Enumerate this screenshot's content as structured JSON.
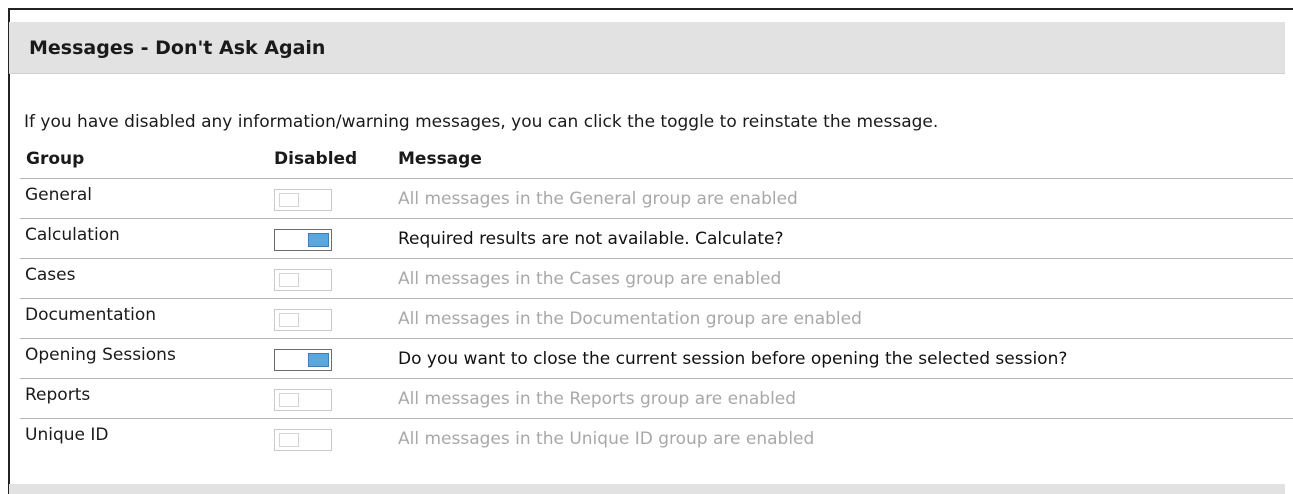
{
  "panel": {
    "title": "Messages - Don't Ask Again",
    "intro": "If you have disabled any information/warning messages, you can click the toggle to reinstate the message."
  },
  "columns": {
    "group": "Group",
    "disabled": "Disabled",
    "message": "Message"
  },
  "rows": [
    {
      "group": "General",
      "disabled": false,
      "message": "All messages in the General group are enabled"
    },
    {
      "group": "Calculation",
      "disabled": true,
      "message": "Required results are not available. Calculate?"
    },
    {
      "group": "Cases",
      "disabled": false,
      "message": "All messages in the Cases group are enabled"
    },
    {
      "group": "Documentation",
      "disabled": false,
      "message": "All messages in the Documentation group are enabled"
    },
    {
      "group": "Opening Sessions",
      "disabled": true,
      "message": "Do you want to close the current session before opening the selected session?"
    },
    {
      "group": "Reports",
      "disabled": false,
      "message": "All messages in the Reports group are enabled"
    },
    {
      "group": "Unique ID",
      "disabled": false,
      "message": "All messages in the Unique ID group are enabled"
    }
  ],
  "colors": {
    "header_bg": "#e2e2e2",
    "toggle_on": "#5aa7dc",
    "muted_text": "#a8a8a8"
  }
}
